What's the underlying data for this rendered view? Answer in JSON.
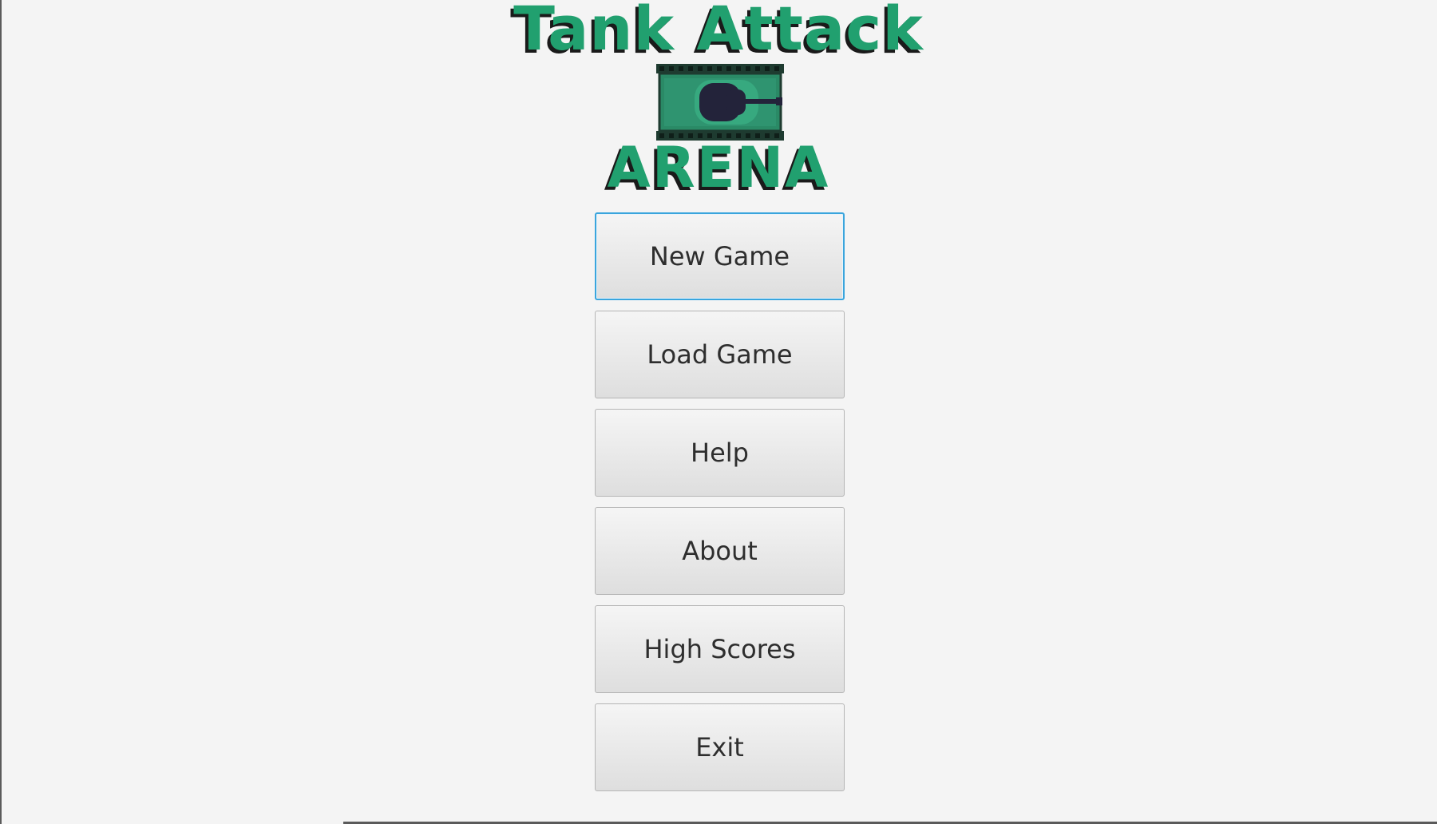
{
  "logo": {
    "title": "Tank Attack",
    "subtitle": "ARENA",
    "icon": "tank-icon",
    "colors": {
      "text": "#21a06f",
      "shadow": "#1a1a1a",
      "tank_body": "#2a8a66",
      "tank_treads": "#1e3b30",
      "turret": "#23233a"
    }
  },
  "menu": {
    "new_game": "New Game",
    "load_game": "Load Game",
    "help": "Help",
    "about": "About",
    "high_scores": "High Scores",
    "exit": "Exit",
    "focus_color": "#3aa5dd"
  }
}
